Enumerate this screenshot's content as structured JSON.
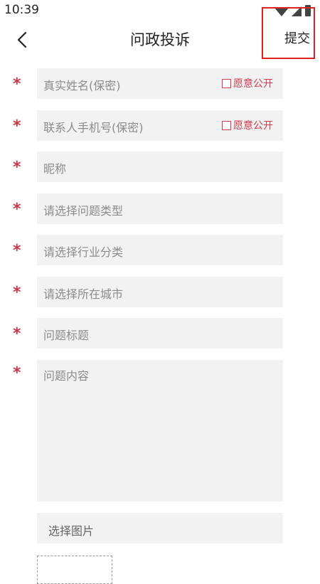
{
  "status_bar": {
    "time": "10:39"
  },
  "header": {
    "title": "问政投诉",
    "submit_label": "提交"
  },
  "form": {
    "required_marker": "*",
    "fields": [
      {
        "placeholder": "真实姓名(保密)",
        "public_label": "愿意公开"
      },
      {
        "placeholder": "联系人手机号(保密)",
        "public_label": "愿意公开"
      },
      {
        "placeholder": "昵称"
      },
      {
        "placeholder": "请选择问题类型"
      },
      {
        "placeholder": "请选择行业分类"
      },
      {
        "placeholder": "请选择所在城市"
      },
      {
        "placeholder": "问题标题"
      },
      {
        "placeholder": "问题内容"
      }
    ],
    "image_picker_label": "选择图片"
  },
  "colors": {
    "accent": "#d23a4e",
    "asterisk": "#c8374a",
    "field_bg": "#f2f2f2",
    "highlight_box": "#e02020"
  }
}
